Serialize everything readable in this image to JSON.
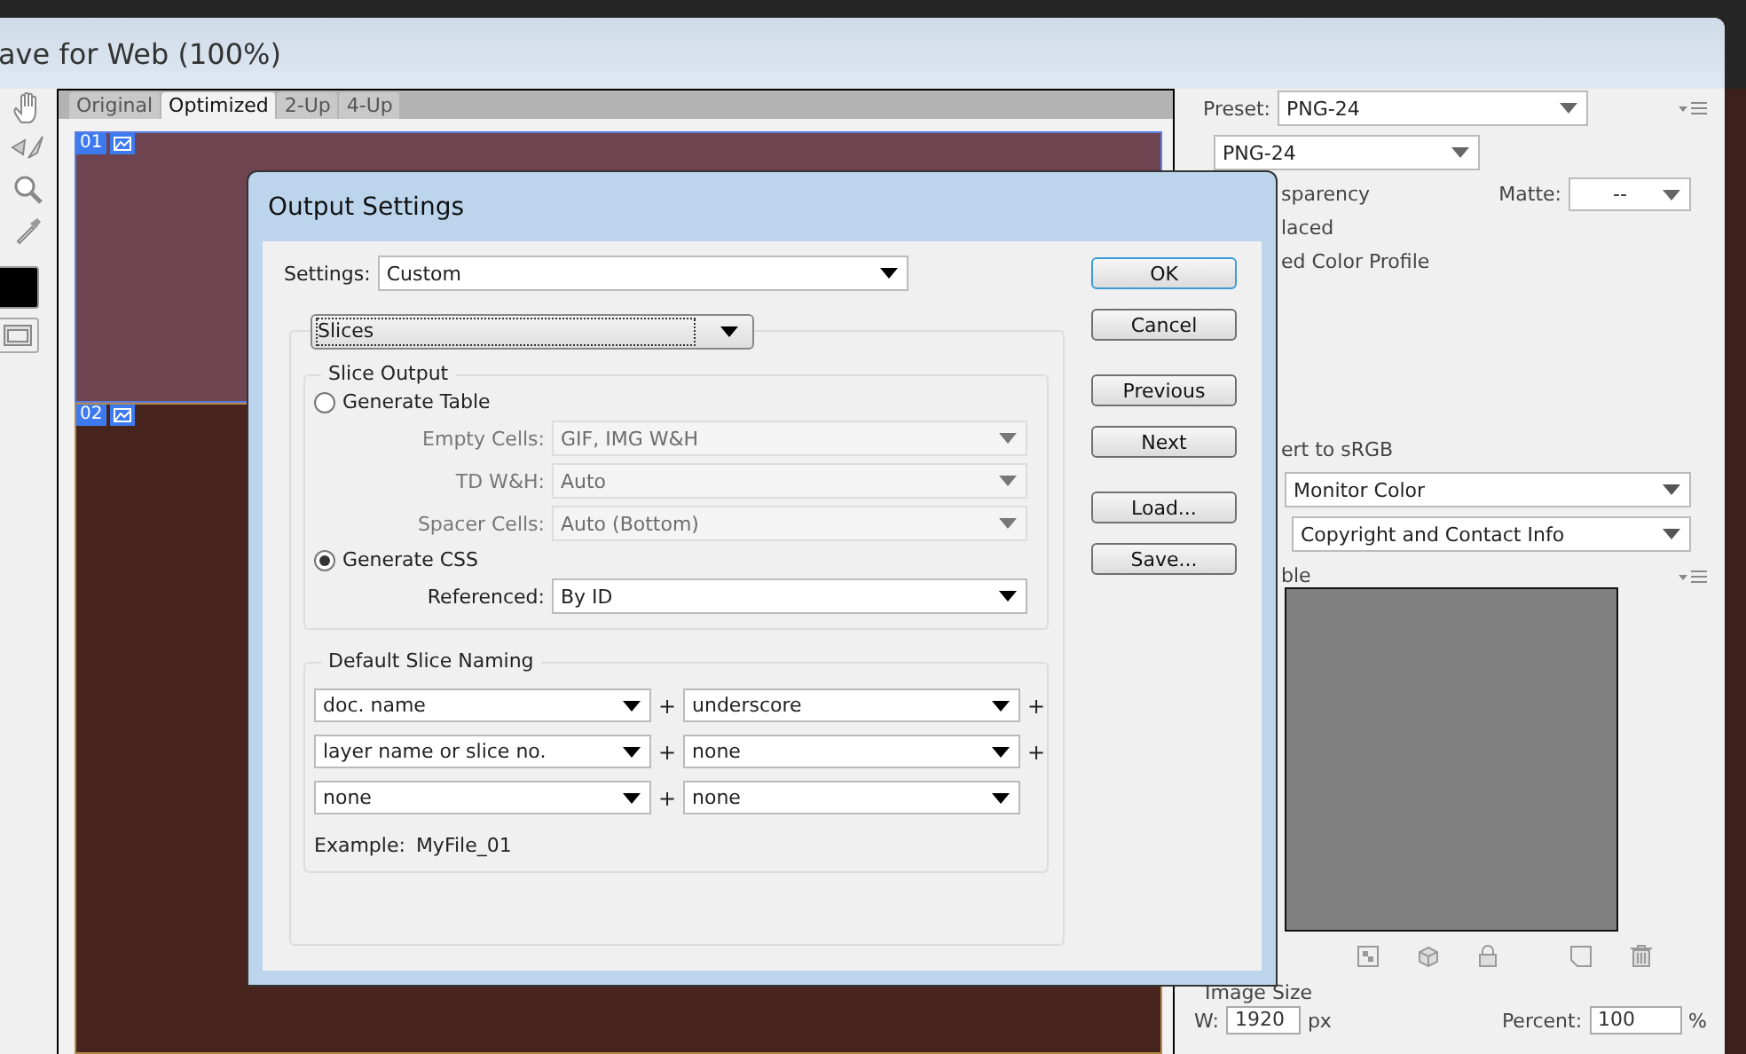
{
  "window": {
    "title": "ave for Web (100%)"
  },
  "view_tabs": [
    {
      "label": "Original",
      "selected": false
    },
    {
      "label": "Optimized",
      "selected": true
    },
    {
      "label": "2-Up",
      "selected": false
    },
    {
      "label": "4-Up",
      "selected": false
    }
  ],
  "slices": [
    {
      "number": "01",
      "selected": true
    },
    {
      "number": "02",
      "selected": false
    }
  ],
  "settings_panel": {
    "preset_label": "Preset:",
    "preset": "PNG-24",
    "format": "PNG-24",
    "options": [
      "sparency",
      "laced",
      "ed Color Profile"
    ],
    "matte_label": "Matte:",
    "matte": "--",
    "convert_label": "ert to sRGB",
    "preview": "Monitor Color",
    "metadata": "Copyright and Contact Info",
    "color_table_title": "ble",
    "image_size": {
      "title": "Image Size",
      "w_label": "W:",
      "w": "1920",
      "w_unit": "px",
      "percent_label": "Percent:",
      "percent": "100",
      "percent_unit": "%"
    }
  },
  "dialog": {
    "title": "Output Settings",
    "settings_label": "Settings:",
    "settings": "Custom",
    "section": "Slices",
    "slice_output": {
      "title": "Slice Output",
      "options": [
        {
          "label": "Generate Table",
          "selected": false,
          "fields": [
            {
              "label": "Empty Cells:",
              "value": "GIF, IMG W&H",
              "disabled": true
            },
            {
              "label": "TD W&H:",
              "value": "Auto",
              "disabled": true
            },
            {
              "label": "Spacer Cells:",
              "value": "Auto (Bottom)",
              "disabled": true
            }
          ]
        },
        {
          "label": "Generate CSS",
          "selected": true,
          "fields": [
            {
              "label": "Referenced:",
              "value": "By ID",
              "disabled": false
            }
          ]
        }
      ]
    },
    "naming": {
      "title": "Default Slice Naming",
      "rows": [
        {
          "first": "doc. name",
          "joiner": "+",
          "second": "underscore",
          "trailing": "+"
        },
        {
          "first": "layer name or slice no.",
          "joiner": "+",
          "second": "none",
          "trailing": "+"
        },
        {
          "first": "none",
          "joiner": "+",
          "second": "none"
        }
      ],
      "example_label": "Example:",
      "example": "MyFile_01"
    },
    "buttons": [
      [
        {
          "label": "OK",
          "default": true
        },
        {
          "label": "Cancel",
          "default": false
        }
      ],
      [
        {
          "label": "Previous",
          "default": false
        },
        {
          "label": "Next",
          "default": false
        }
      ],
      [
        {
          "label": "Load...",
          "default": false
        },
        {
          "label": "Save...",
          "default": false
        }
      ]
    ]
  }
}
